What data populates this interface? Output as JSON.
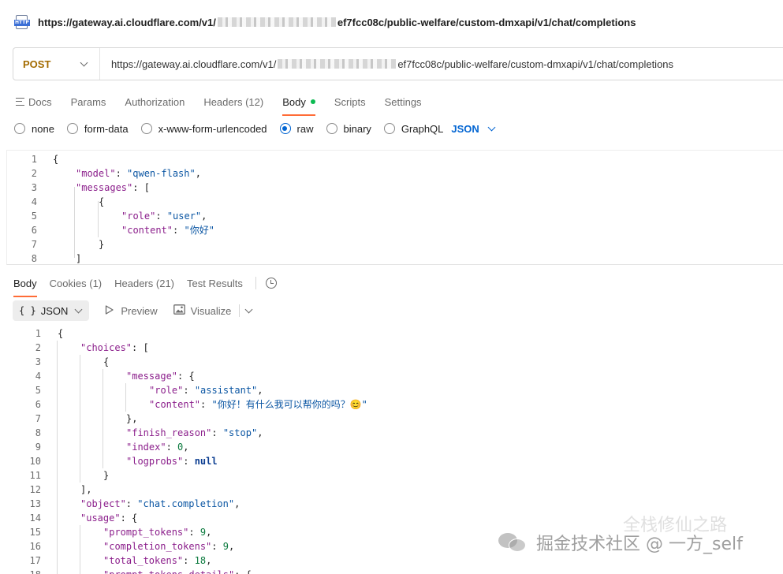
{
  "title_bar": {
    "icon": "http-file-icon",
    "icon_tag": "HTTP",
    "url_start": "https://gateway.ai.cloudflare.com/v1/",
    "url_end": "ef7fcc08c/public-welfare/custom-dmxapi/v1/chat/completions"
  },
  "request": {
    "method": "POST",
    "method_color": "#a36b00",
    "url_start": "https://gateway.ai.cloudflare.com/v1/",
    "url_end": "ef7fcc08c/public-welfare/custom-dmxapi/v1/chat/completions"
  },
  "request_tabs": {
    "docs": "Docs",
    "params": "Params",
    "authorization": "Authorization",
    "headers": "Headers",
    "headers_count": "(12)",
    "body": "Body",
    "scripts": "Scripts",
    "settings": "Settings"
  },
  "body_types": {
    "none": "none",
    "form_data": "form-data",
    "urlencoded": "x-www-form-urlencoded",
    "raw": "raw",
    "binary": "binary",
    "graphql": "GraphQL",
    "format": "JSON",
    "selected": "raw"
  },
  "request_body_lines": [
    {
      "n": "1",
      "t": "{"
    },
    {
      "n": "2",
      "t": "\"model\": \"qwen-flash\","
    },
    {
      "n": "3",
      "t": "\"messages\": ["
    },
    {
      "n": "4",
      "t": "{"
    },
    {
      "n": "5",
      "t": "\"role\": \"user\","
    },
    {
      "n": "6",
      "t": "\"content\": \"你好\""
    },
    {
      "n": "7",
      "t": "}"
    },
    {
      "n": "8",
      "t": "]"
    }
  ],
  "response_tabs": {
    "body": "Body",
    "cookies": "Cookies",
    "cookies_count": "(1)",
    "headers": "Headers",
    "headers_count": "(21)",
    "test_results": "Test Results"
  },
  "response_toolbar": {
    "format_braces": "{ }",
    "format": "JSON",
    "preview": "Preview",
    "visualize": "Visualize"
  },
  "response_body_lines": [
    {
      "n": "1",
      "t": "{"
    },
    {
      "n": "2",
      "t": "\"choices\": ["
    },
    {
      "n": "3",
      "t": "{"
    },
    {
      "n": "4",
      "t": "\"message\": {"
    },
    {
      "n": "5",
      "t": "\"role\": \"assistant\","
    },
    {
      "n": "6",
      "t": "\"content\": \"你好！有什么我可以帮你的吗？😊\""
    },
    {
      "n": "7",
      "t": "},"
    },
    {
      "n": "8",
      "t": "\"finish_reason\": \"stop\","
    },
    {
      "n": "9",
      "t": "\"index\": 0,"
    },
    {
      "n": "10",
      "t": "\"logprobs\": null"
    },
    {
      "n": "11",
      "t": "}"
    },
    {
      "n": "12",
      "t": "],"
    },
    {
      "n": "13",
      "t": "\"object\": \"chat.completion\","
    },
    {
      "n": "14",
      "t": "\"usage\": {"
    },
    {
      "n": "15",
      "t": "\"prompt_tokens\": 9,"
    },
    {
      "n": "16",
      "t": "\"completion_tokens\": 9,"
    },
    {
      "n": "17",
      "t": "\"total_tokens\": 18,"
    },
    {
      "n": "18",
      "t": "\"prompt_tokens_details\": {"
    }
  ],
  "watermark": {
    "icon": "wechat-icon",
    "text": "掘金技术社区 @ 一方_self",
    "overlay_text": "全栈修仙之路"
  },
  "colors": {
    "accent_orange": "#ff6c37",
    "link_blue": "#0265d2",
    "status_green": "#0cbb52",
    "json_key": "#8b1e8b",
    "json_string": "#0b56a3"
  }
}
